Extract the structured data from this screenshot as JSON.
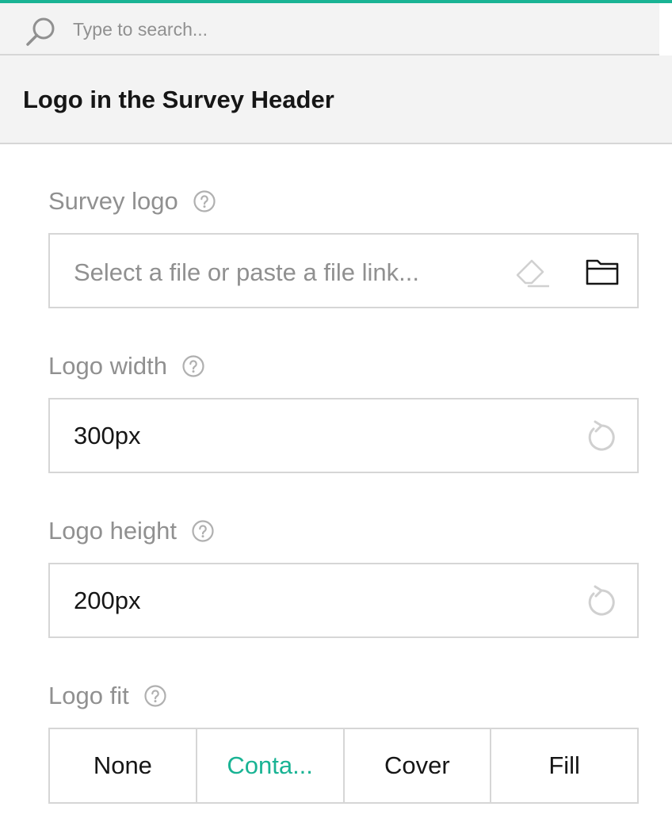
{
  "search": {
    "placeholder": "Type to search..."
  },
  "section": {
    "title": "Logo in the Survey Header"
  },
  "properties": {
    "survey_logo": {
      "label": "Survey logo",
      "placeholder": "Select a file or paste a file link..."
    },
    "logo_width": {
      "label": "Logo width",
      "value": "300px"
    },
    "logo_height": {
      "label": "Logo height",
      "value": "200px"
    },
    "logo_fit": {
      "label": "Logo fit",
      "options": [
        "None",
        "Conta...",
        "Cover",
        "Fill"
      ],
      "selected": "Conta..."
    }
  },
  "colors": {
    "accent": "#19b394",
    "label": "#909090",
    "text": "#161616",
    "border": "#d6d6d6",
    "panel_background": "#f3f3f3"
  },
  "icons": [
    "search-icon",
    "help-icon",
    "eraser-icon",
    "folder-icon",
    "reset-icon"
  ]
}
